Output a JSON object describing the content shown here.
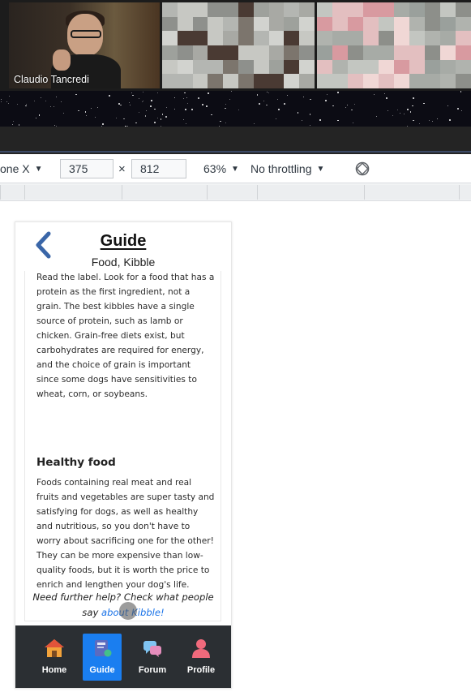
{
  "video_call": {
    "participant_name": "Claudio Tancredi"
  },
  "devtools": {
    "device_select": "one X",
    "width": "375",
    "times": "×",
    "height": "812",
    "zoom": "63%",
    "throttling": "No throttling",
    "rotate_icon": "rotate-icon"
  },
  "app": {
    "title": "Guide",
    "subtitle": "Food, Kibble",
    "paragraph_1": "Read the label. Look for a food that has a protein as the first ingredient, not a grain. The best kibbles have a single source of protein, such as lamb or chicken. Grain-free diets exist, but carbohydrates are required for energy, and the choice of grain is important since some dogs have sensitivities to wheat, corn, or soybeans.",
    "section_heading": "Healthy food",
    "paragraph_2": "Foods containing real meat and real fruits and vegetables are super tasty and satisfying for dogs, as well as healthy and nutritious, so you don't have to worry about sacrificing one for the other! They can be more expensive than low-quality foods, but it is worth the price to enrich and lengthen your dog's life.",
    "help_prefix": "Need further help? Check what people say ",
    "help_link": "about Kibble!",
    "nav": [
      {
        "label": "Home",
        "icon": "house-icon"
      },
      {
        "label": "Guide",
        "icon": "book-icon",
        "active": true
      },
      {
        "label": "Forum",
        "icon": "chat-bubbles-icon"
      },
      {
        "label": "Profile",
        "icon": "person-icon"
      }
    ],
    "colors": {
      "accent": "#1a7ef0",
      "nav_background": "#2b2f33",
      "back_arrow": "#3a66a8",
      "link": "#1a73e8"
    }
  }
}
